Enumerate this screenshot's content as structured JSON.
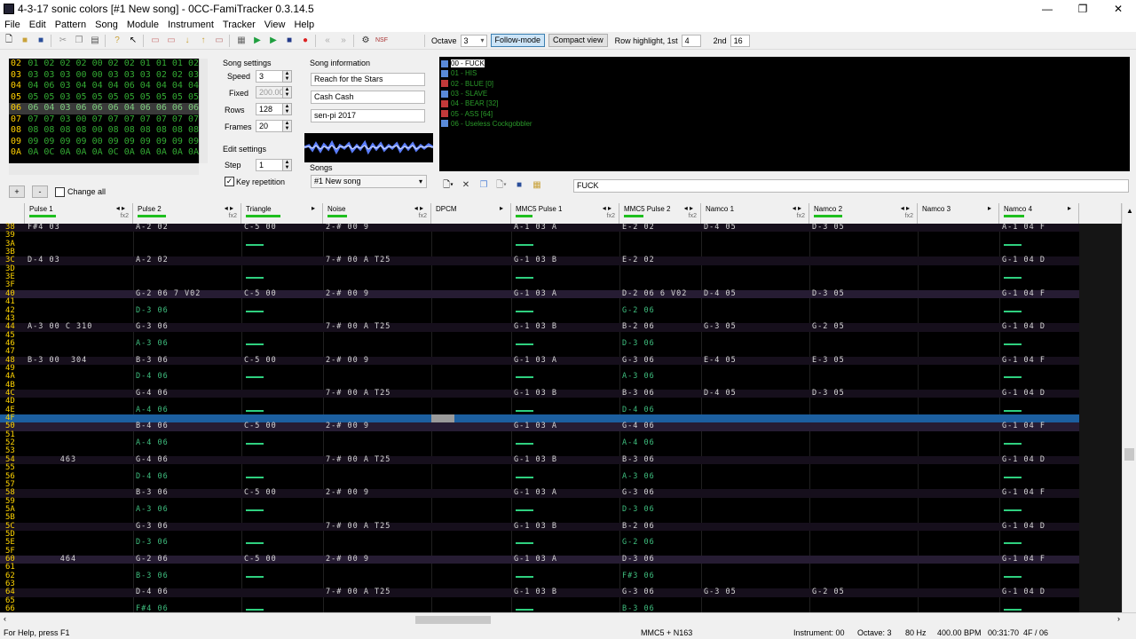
{
  "window": {
    "title": "4-3-17 sonic colors [#1 New song] - 0CC-FamiTracker 0.3.14.5",
    "min": "—",
    "max": "❐",
    "close": "✕"
  },
  "menu": [
    "File",
    "Edit",
    "Pattern",
    "Song",
    "Module",
    "Instrument",
    "Tracker",
    "View",
    "Help"
  ],
  "toolbar": {
    "octave_label": "Octave",
    "octave_value": "3",
    "follow_mode": "Follow-mode",
    "compact_view": "Compact view",
    "row_highlight_label": "Row highlight, 1st",
    "row_highlight_1st": "4",
    "second_label": "2nd",
    "row_highlight_2nd": "16",
    "nsf_label": "NSF"
  },
  "frames": {
    "rows": [
      {
        "n": "02",
        "cells": "01 02 02 02 00 02 02 01 01 01 02"
      },
      {
        "n": "03",
        "cells": "03 03 03 00 00 03 03 03 02 02 03"
      },
      {
        "n": "04",
        "cells": "04 06 03 04 04 04 06 04 04 04 04"
      },
      {
        "n": "05",
        "cells": "05 05 03 05 05 05 05 05 05 05 05"
      },
      {
        "n": "06",
        "cells": "06 04 03 06 06 06 04 06 06 06 06"
      },
      {
        "n": "07",
        "cells": "07 07 03 00 07 07 07 07 07 07 07"
      },
      {
        "n": "08",
        "cells": "08 08 08 08 00 08 08 08 08 08 08"
      },
      {
        "n": "09",
        "cells": "09 09 09 09 00 09 09 09 09 09 09"
      },
      {
        "n": "0A",
        "cells": "0A 0C 0A 0A 0A 0C 0A 0A 0A 0A 0A"
      }
    ],
    "plus": "+",
    "minus": "-",
    "change_all": "Change all"
  },
  "song_settings": {
    "title": "Song settings",
    "speed_label": "Speed",
    "speed": "3",
    "fixed_label": "Fixed",
    "fixed": "200.00",
    "rows_label": "Rows",
    "rows": "128",
    "frames_label": "Frames",
    "frames": "20"
  },
  "edit_settings": {
    "title": "Edit settings",
    "step_label": "Step",
    "step": "1",
    "key_repetition": "Key repetition"
  },
  "song_info": {
    "title": "Song information",
    "name": "Reach for the Stars",
    "artist": "Cash Cash",
    "copyright": "sen-pi 2017",
    "songs_label": "Songs",
    "song_selected": "#1 New song"
  },
  "instruments": [
    {
      "name": "00 - FUCK",
      "kind": "2A03",
      "selected": true
    },
    {
      "name": "01 - HIS",
      "kind": "2A03"
    },
    {
      "name": "02 - BLUE [0]",
      "kind": "N163"
    },
    {
      "name": "03 - SLAVE",
      "kind": "2A03"
    },
    {
      "name": "04 - BEAR [32]",
      "kind": "N163"
    },
    {
      "name": "05 - ASS [64]",
      "kind": "N163"
    },
    {
      "name": "06 - Useless Cockgobbler",
      "kind": "2A03"
    }
  ],
  "instrument_name": "FUCK",
  "channels": [
    {
      "name": "Pulse 1",
      "fx": "fx2",
      "meter": 28
    },
    {
      "name": "Pulse 2",
      "fx": "fx2",
      "meter": 30
    },
    {
      "name": "Triangle",
      "fx": "",
      "meter": 50
    },
    {
      "name": "Noise",
      "fx": "fx2",
      "meter": 20
    },
    {
      "name": "DPCM",
      "fx": "",
      "meter": 0
    },
    {
      "name": "MMC5 Pulse 1",
      "fx": "fx2",
      "meter": 18
    },
    {
      "name": "MMC5 Pulse 2",
      "fx": "fx2",
      "meter": 28
    },
    {
      "name": "Namco 1",
      "fx": "fx2",
      "meter": 0
    },
    {
      "name": "Namco 2",
      "fx": "fx2",
      "meter": 30
    },
    {
      "name": "Namco 3",
      "fx": "",
      "meter": 0
    },
    {
      "name": "Namco 4",
      "fx": "",
      "meter": 30
    }
  ],
  "pattern_rows": [
    {
      "n": "38",
      "c": [
        "F#4 03",
        "A-2 02",
        "C-5 00",
        "2-# 00 9",
        "",
        "A-1 03 A",
        "E-2 02",
        "D-4 05",
        "D-3 05",
        "",
        "A-1 04 F"
      ]
    },
    {
      "n": "39",
      "c": [
        "",
        "",
        "",
        "",
        "",
        "",
        "",
        "",
        "",
        "",
        ""
      ]
    },
    {
      "n": "3A",
      "c": [
        "",
        "",
        "",
        "",
        "",
        "",
        "",
        "",
        "",
        "",
        ""
      ]
    },
    {
      "n": "3B",
      "c": [
        "",
        "",
        "",
        "",
        "",
        "",
        "",
        "",
        "",
        "",
        ""
      ]
    },
    {
      "n": "3C",
      "c": [
        "D-4 03",
        "A-2 02",
        "",
        "7-# 00 A T25",
        "",
        "G-1 03 B",
        "E-2 02",
        "",
        "",
        "",
        "G-1 04 D"
      ]
    },
    {
      "n": "3D",
      "c": [
        "",
        "",
        "",
        "",
        "",
        "",
        "",
        "",
        "",
        "",
        ""
      ]
    },
    {
      "n": "3E",
      "c": [
        "",
        "",
        "",
        "",
        "",
        "",
        "",
        "",
        "",
        "",
        ""
      ]
    },
    {
      "n": "3F",
      "c": [
        "",
        "",
        "",
        "",
        "",
        "",
        "",
        "",
        "",
        "",
        ""
      ]
    },
    {
      "n": "40",
      "c": [
        "",
        "G-2 06 7 V02",
        "C-5 00",
        "2-# 00 9",
        "",
        "G-1 03 A",
        "D-2 06 6 V02",
        "D-4 05",
        "D-3 05",
        "",
        "G-1 04 F"
      ]
    },
    {
      "n": "41",
      "c": [
        "",
        "",
        "",
        "",
        "",
        "",
        "",
        "",
        "",
        "",
        ""
      ]
    },
    {
      "n": "42",
      "c": [
        "",
        "D-3 06",
        "",
        "",
        "",
        "",
        "G-2 06",
        "",
        "",
        "",
        ""
      ]
    },
    {
      "n": "43",
      "c": [
        "",
        "",
        "",
        "",
        "",
        "",
        "",
        "",
        "",
        "",
        ""
      ]
    },
    {
      "n": "44",
      "c": [
        "A-3 00 C 310",
        "G-3 06",
        "",
        "7-# 00 A T25",
        "",
        "G-1 03 B",
        "B-2 06",
        "G-3 05",
        "G-2 05",
        "",
        "G-1 04 D"
      ]
    },
    {
      "n": "45",
      "c": [
        "",
        "",
        "",
        "",
        "",
        "",
        "",
        "",
        "",
        "",
        ""
      ]
    },
    {
      "n": "46",
      "c": [
        "",
        "A-3 06",
        "",
        "",
        "",
        "",
        "D-3 06",
        "",
        "",
        "",
        ""
      ]
    },
    {
      "n": "47",
      "c": [
        "",
        "",
        "",
        "",
        "",
        "",
        "",
        "",
        "",
        "",
        ""
      ]
    },
    {
      "n": "48",
      "c": [
        "B-3 00  304",
        "B-3 06",
        "C-5 00",
        "2-# 00 9",
        "",
        "G-1 03 A",
        "G-3 06",
        "E-4 05",
        "E-3 05",
        "",
        "G-1 04 F"
      ]
    },
    {
      "n": "49",
      "c": [
        "",
        "",
        "",
        "",
        "",
        "",
        "",
        "",
        "",
        "",
        ""
      ]
    },
    {
      "n": "4A",
      "c": [
        "",
        "D-4 06",
        "",
        "",
        "",
        "",
        "A-3 06",
        "",
        "",
        "",
        ""
      ]
    },
    {
      "n": "4B",
      "c": [
        "",
        "",
        "",
        "",
        "",
        "",
        "",
        "",
        "",
        "",
        ""
      ]
    },
    {
      "n": "4C",
      "c": [
        "",
        "G-4 06",
        "",
        "7-# 00 A T25",
        "",
        "G-1 03 B",
        "B-3 06",
        "D-4 05",
        "D-3 05",
        "",
        "G-1 04 D"
      ]
    },
    {
      "n": "4D",
      "c": [
        "",
        "",
        "",
        "",
        "",
        "",
        "",
        "",
        "",
        "",
        ""
      ]
    },
    {
      "n": "4E",
      "c": [
        "",
        "A-4 06",
        "",
        "",
        "",
        "",
        "D-4 06",
        "",
        "",
        "",
        ""
      ]
    },
    {
      "n": "4F",
      "c": [
        "",
        "",
        "",
        "",
        "",
        "",
        "",
        "",
        "",
        "",
        ""
      ]
    },
    {
      "n": "50",
      "c": [
        "",
        "B-4 06",
        "C-5 00",
        "2-# 00 9",
        "",
        "G-1 03 A",
        "G-4 06",
        "",
        "",
        "",
        "G-1 04 F"
      ]
    },
    {
      "n": "51",
      "c": [
        "",
        "",
        "",
        "",
        "",
        "",
        "",
        "",
        "",
        "",
        ""
      ]
    },
    {
      "n": "52",
      "c": [
        "",
        "A-4 06",
        "",
        "",
        "",
        "",
        "A-4 06",
        "",
        "",
        "",
        ""
      ]
    },
    {
      "n": "53",
      "c": [
        "",
        "",
        "",
        "",
        "",
        "",
        "",
        "",
        "",
        "",
        ""
      ]
    },
    {
      "n": "54",
      "c": [
        "      463",
        "G-4 06",
        "",
        "7-# 00 A T25",
        "",
        "G-1 03 B",
        "B-3 06",
        "",
        "",
        "",
        "G-1 04 D"
      ]
    },
    {
      "n": "55",
      "c": [
        "",
        "",
        "",
        "",
        "",
        "",
        "",
        "",
        "",
        "",
        ""
      ]
    },
    {
      "n": "56",
      "c": [
        "",
        "D-4 06",
        "",
        "",
        "",
        "",
        "A-3 06",
        "",
        "",
        "",
        ""
      ]
    },
    {
      "n": "57",
      "c": [
        "",
        "",
        "",
        "",
        "",
        "",
        "",
        "",
        "",
        "",
        ""
      ]
    },
    {
      "n": "58",
      "c": [
        "",
        "B-3 06",
        "C-5 00",
        "2-# 00 9",
        "",
        "G-1 03 A",
        "G-3 06",
        "",
        "",
        "",
        "G-1 04 F"
      ]
    },
    {
      "n": "59",
      "c": [
        "",
        "",
        "",
        "",
        "",
        "",
        "",
        "",
        "",
        "",
        ""
      ]
    },
    {
      "n": "5A",
      "c": [
        "",
        "A-3 06",
        "",
        "",
        "",
        "",
        "D-3 06",
        "",
        "",
        "",
        ""
      ]
    },
    {
      "n": "5B",
      "c": [
        "",
        "",
        "",
        "",
        "",
        "",
        "",
        "",
        "",
        "",
        ""
      ]
    },
    {
      "n": "5C",
      "c": [
        "",
        "G-3 06",
        "",
        "7-# 00 A T25",
        "",
        "G-1 03 B",
        "B-2 06",
        "",
        "",
        "",
        "G-1 04 D"
      ]
    },
    {
      "n": "5D",
      "c": [
        "",
        "",
        "",
        "",
        "",
        "",
        "",
        "",
        "",
        "",
        ""
      ]
    },
    {
      "n": "5E",
      "c": [
        "",
        "D-3 06",
        "",
        "",
        "",
        "",
        "G-2 06",
        "",
        "",
        "",
        ""
      ]
    },
    {
      "n": "5F",
      "c": [
        "",
        "",
        "",
        "",
        "",
        "",
        "",
        "",
        "",
        "",
        ""
      ]
    },
    {
      "n": "60",
      "c": [
        "      464",
        "G-2 06",
        "C-5 00",
        "2-# 00 9",
        "",
        "G-1 03 A",
        "D-3 06",
        "",
        "",
        "",
        "G-1 04 F"
      ]
    },
    {
      "n": "61",
      "c": [
        "",
        "",
        "",
        "",
        "",
        "",
        "",
        "",
        "",
        "",
        ""
      ]
    },
    {
      "n": "62",
      "c": [
        "",
        "B-3 06",
        "",
        "",
        "",
        "",
        "F#3 06",
        "",
        "",
        "",
        ""
      ]
    },
    {
      "n": "63",
      "c": [
        "",
        "",
        "",
        "",
        "",
        "",
        "",
        "",
        "",
        "",
        ""
      ]
    },
    {
      "n": "64",
      "c": [
        "",
        "D-4 06",
        "",
        "7-# 00 A T25",
        "",
        "G-1 03 B",
        "G-3 06",
        "G-3 05",
        "G-2 05",
        "",
        "G-1 04 D"
      ]
    },
    {
      "n": "65",
      "c": [
        "",
        "",
        "",
        "",
        "",
        "",
        "",
        "",
        "",
        "",
        ""
      ]
    },
    {
      "n": "66",
      "c": [
        "",
        "F#4 06",
        "",
        "",
        "",
        "",
        "B-3 06",
        "",
        "",
        "",
        ""
      ]
    }
  ],
  "status": {
    "help": "For Help, press F1",
    "chips": "MMC5 + N163",
    "instrument": "Instrument: 00",
    "octave": "Octave: 3",
    "rate": "80 Hz",
    "bpm": "400.00 BPM",
    "time": "00:31:70",
    "frame": "4F / 06"
  }
}
